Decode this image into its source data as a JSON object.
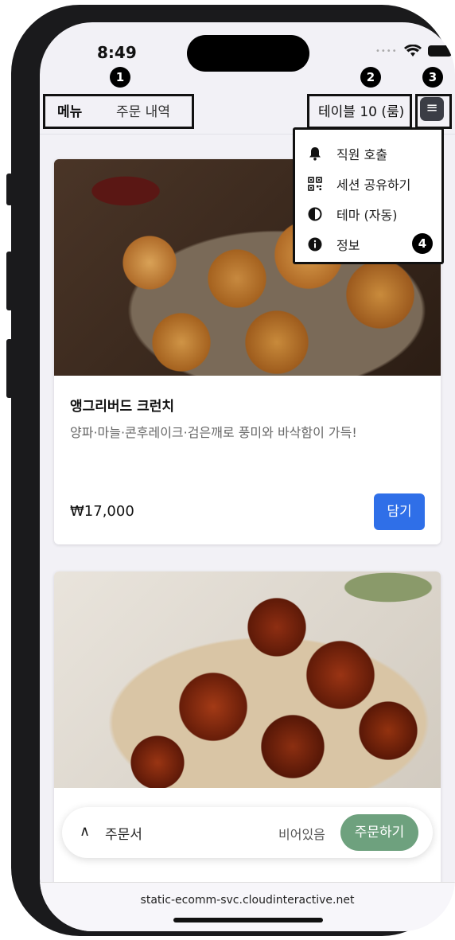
{
  "status_bar": {
    "time": "8:49"
  },
  "markers": [
    "1",
    "2",
    "3",
    "4"
  ],
  "nav": {
    "tabs": [
      {
        "label": "메뉴"
      },
      {
        "label": "주문 내역"
      }
    ]
  },
  "table": {
    "label": "테이블 10 (룸)"
  },
  "menu_button": {
    "icon": "≡"
  },
  "dropdown": {
    "items": [
      {
        "label": "직원 호출",
        "icon": "bell-icon"
      },
      {
        "label": "세션 공유하기",
        "icon": "qr-code-icon"
      },
      {
        "label": "테마 (자동)",
        "icon": "contrast-icon"
      },
      {
        "label": "정보",
        "icon": "info-icon"
      }
    ]
  },
  "items": [
    {
      "name": "앵그리버드 크런치",
      "description": "양파·마늘·콘후레이크·검은깨로 풍미와 바삭함이 가득!",
      "price": "₩17,000",
      "add_label": "담기"
    }
  ],
  "order_bar": {
    "label": "주문서",
    "status": "비어있음",
    "button": "주문하기"
  },
  "browser": {
    "url": "static-ecomm-svc.cloudinteractive.net"
  }
}
